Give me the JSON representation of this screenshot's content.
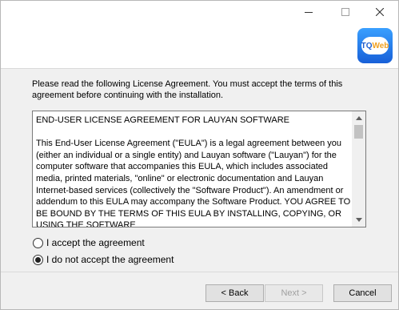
{
  "window": {
    "controls": {
      "minimize_icon": "minimize-icon",
      "maximize_icon": "maximize-icon",
      "close_icon": "close-icon"
    }
  },
  "header": {
    "logo": {
      "text_prefix": "TQ",
      "text_suffix": "Web",
      "icon": "tqweb-logo"
    }
  },
  "intro": "Please read the following License Agreement. You must accept the terms of this agreement before continuing with the installation.",
  "eula": {
    "heading": "END-USER LICENSE AGREEMENT FOR LAUYAN SOFTWARE",
    "body": "This End-User License Agreement (\"EULA\") is a legal agreement between you (either an individual or a single entity) and Lauyan software (\"Lauyan\") for the computer software that accompanies this EULA, which includes associated media, printed materials, \"online\" or electronic documentation and Lauyan Internet-based services (collectively the \"Software Product\"). An amendment or addendum to this EULA may accompany the Software Product. YOU AGREE TO BE BOUND BY THE TERMS OF THIS EULA BY INSTALLING, COPYING, OR USING THE SOFTWARE"
  },
  "options": [
    {
      "label": "I accept the agreement",
      "selected": false
    },
    {
      "label": "I do not accept the agreement",
      "selected": true
    }
  ],
  "buttons": {
    "back": "< Back",
    "next": "Next >",
    "cancel": "Cancel",
    "next_enabled": false
  },
  "colors": {
    "logo_gradient_top": "#3aa0ff",
    "logo_gradient_bottom": "#1860d8",
    "logo_web": "#f0a020"
  }
}
